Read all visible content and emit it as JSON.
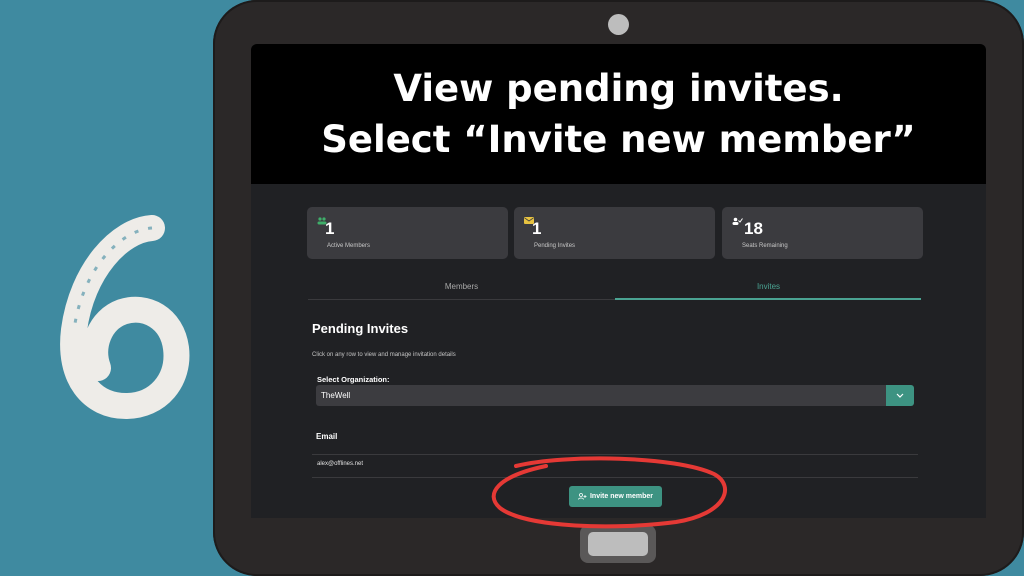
{
  "step_number": "6",
  "banner": {
    "line1": "View pending invites.",
    "line2": "Select “Invite new member”"
  },
  "stats": [
    {
      "value": "1",
      "label": "Active Members",
      "icon": "people-icon",
      "color": "#3fae6a"
    },
    {
      "value": "1",
      "label": "Pending Invites",
      "icon": "envelope-icon",
      "color": "#e8c341"
    },
    {
      "value": "18",
      "label": "Seats Remaining",
      "icon": "user-check-icon",
      "color": "#ffffff"
    }
  ],
  "tabs": {
    "members": "Members",
    "invites": "Invites",
    "active": "Invites",
    "accent": "#4aa392"
  },
  "pending": {
    "title": "Pending Invites",
    "subtitle": "Click on any row to view and manage invitation details"
  },
  "organization": {
    "label": "Select Organization:",
    "value": "TheWell"
  },
  "table": {
    "header_email": "Email",
    "rows": [
      {
        "email": "alex@offlines.net"
      }
    ]
  },
  "invite_button": {
    "label": "Invite new member",
    "icon": "user-plus-icon"
  },
  "annotation_color": "#e53935"
}
